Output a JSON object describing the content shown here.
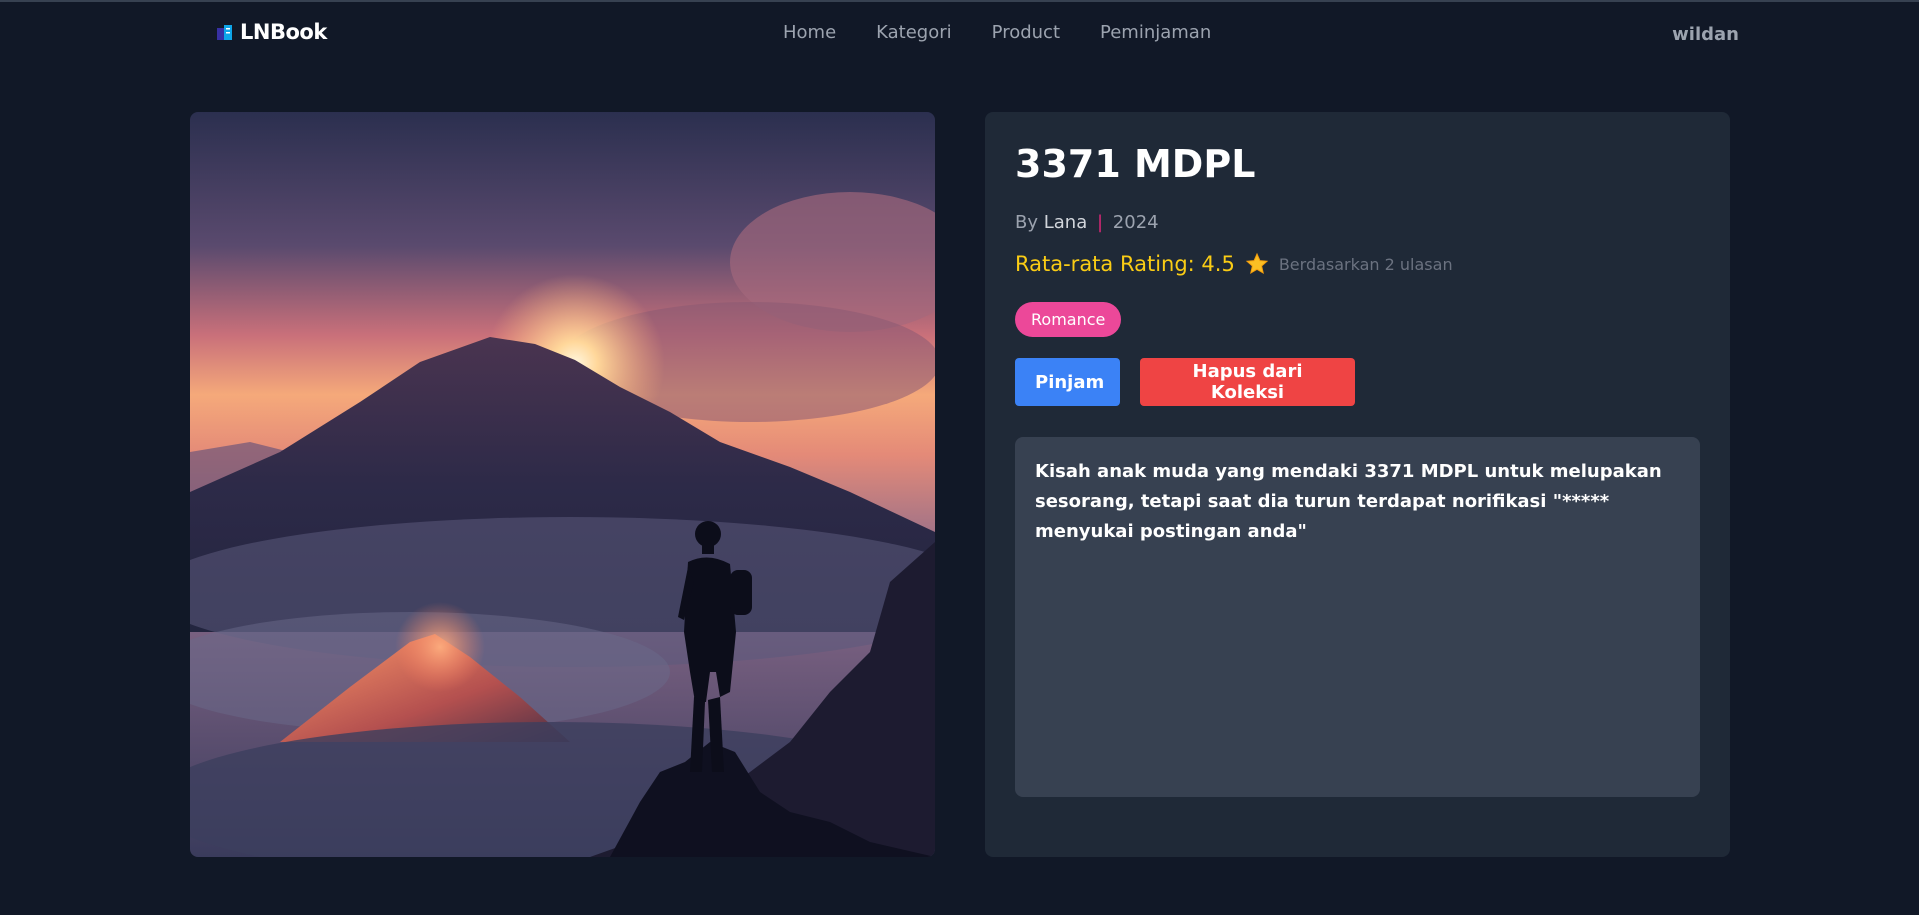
{
  "brand": {
    "name": "LNBook",
    "icon": "book-icon"
  },
  "nav": {
    "links": [
      {
        "label": "Home"
      },
      {
        "label": "Kategori"
      },
      {
        "label": "Product"
      },
      {
        "label": "Peminjaman"
      }
    ],
    "user": "wildan"
  },
  "book": {
    "title": "3371 MDPL",
    "by_label": "By",
    "author": "Lana",
    "separator": "|",
    "year": "2024",
    "rating_label": "Rata-rata Rating: 4.5",
    "rating_value": 4.5,
    "rating_count_label": "Berdasarkan 2 ulasan",
    "category": "Romance",
    "description": "Kisah anak muda yang mendaki 3371 MDPL untuk melupakan sesorang, tetapi saat dia turun terdapat norifikasi \"***** menyukai postingan anda\"",
    "cover_alt": "mountain-hiker-sunset-cover"
  },
  "actions": {
    "borrow_label": "Pinjam",
    "remove_label": "Hapus dari Koleksi"
  },
  "colors": {
    "background": "#111827",
    "card": "#1f2937",
    "description_box": "#374151",
    "rating": "#facc15",
    "badge": "#ec4899",
    "borrow_button": "#3b82f6",
    "remove_button": "#ef4444"
  }
}
